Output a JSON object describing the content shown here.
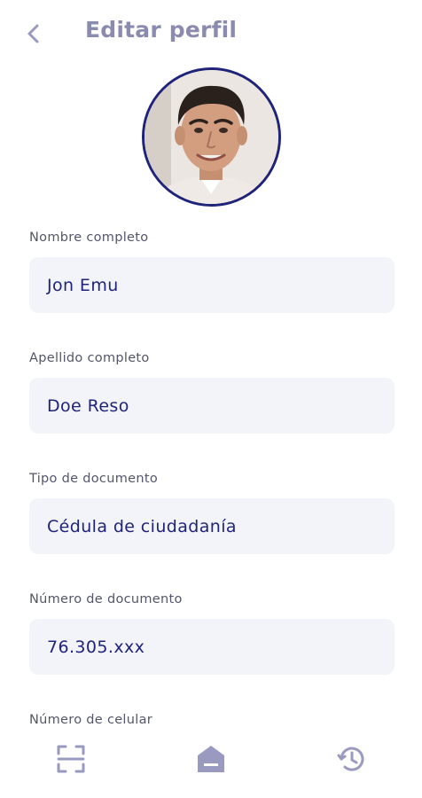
{
  "header": {
    "title": "Editar perfil",
    "back_icon": "chevron-left-icon"
  },
  "profile": {
    "avatar": "profile-photo"
  },
  "form": {
    "fields": [
      {
        "label": "Nombre completo",
        "value": "Jon Emu"
      },
      {
        "label": "Apellido completo",
        "value": "Doe Reso"
      },
      {
        "label": "Tipo de documento",
        "value": "Cédula de ciudadanía"
      },
      {
        "label": "Número de documento",
        "value": "76.305.xxx"
      },
      {
        "label": "Número de celular",
        "value": ""
      }
    ]
  },
  "bottom_nav": {
    "items": [
      {
        "icon": "scan-icon"
      },
      {
        "icon": "home-icon"
      },
      {
        "icon": "history-icon"
      }
    ]
  },
  "colors": {
    "primary": "#1f237a",
    "title": "#8b8bb0",
    "field_bg": "#f3f4f9",
    "icon": "#9a9ac0"
  }
}
